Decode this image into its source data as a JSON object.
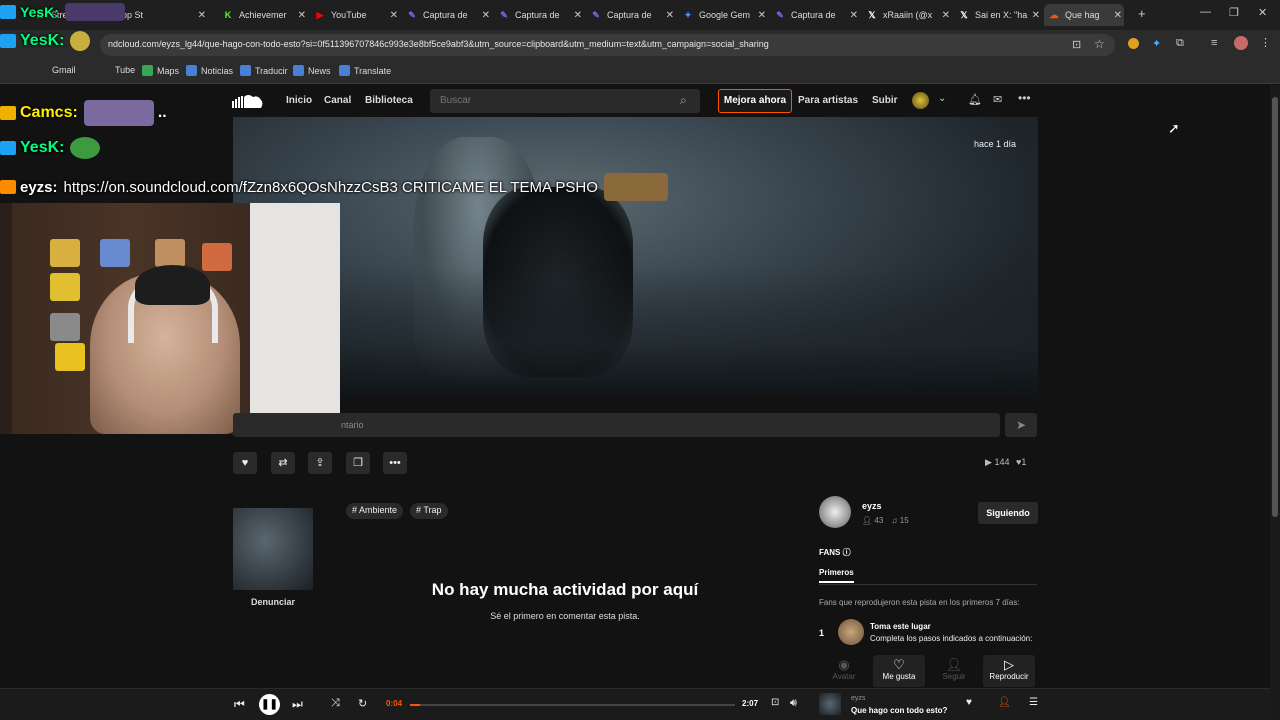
{
  "browser": {
    "tabs": [
      {
        "label": "Stream - Kic",
        "icon": "kick-icon",
        "color": "#53fc18"
      },
      {
        "label": "app St",
        "icon": "app-icon",
        "color": "#888888"
      },
      {
        "label": "Achievemer",
        "icon": "kick-icon",
        "color": "#53fc18"
      },
      {
        "label": "YouTube",
        "icon": "youtube-icon",
        "color": "#ff0000"
      },
      {
        "label": "Captura de",
        "icon": "capture-icon",
        "color": "#8a5cf6"
      },
      {
        "label": "Captura de",
        "icon": "capture-icon",
        "color": "#8a5cf6"
      },
      {
        "label": "Captura de",
        "icon": "capture-icon",
        "color": "#8a5cf6"
      },
      {
        "label": "Google Gem",
        "icon": "gemini-icon",
        "color": "#4a8cff"
      },
      {
        "label": "Captura de",
        "icon": "capture-icon",
        "color": "#8a5cf6"
      },
      {
        "label": "xRaaiin (@x",
        "icon": "x-icon",
        "color": "#ffffff"
      },
      {
        "label": "Sai en X: \"ha",
        "icon": "x-icon",
        "color": "#ffffff"
      },
      {
        "label": "Que hag",
        "icon": "soundcloud-icon",
        "color": "#ff5500"
      }
    ],
    "url": "ndcloud.com/eyzs_lg44/que-hago-con-todo-esto?si=0f511396707846c993e3e8bf5ce9abf3&utm_source=clipboard&utm_medium=text&utm_campaign=social_sharing",
    "bookmarks": [
      {
        "label": "Gmail"
      },
      {
        "label": "Tube"
      },
      {
        "label": "Maps"
      },
      {
        "label": "Noticias"
      },
      {
        "label": "Traducir"
      },
      {
        "label": "News"
      },
      {
        "label": "Translate"
      }
    ]
  },
  "chat": [
    {
      "user": "YesK:",
      "text": "",
      "user_color": "#00ff7f"
    },
    {
      "user": "YesK:",
      "text": "",
      "user_color": "#00ff7f"
    },
    {
      "user": "Camcs:",
      "text": "..",
      "user_color": "#ffee00"
    },
    {
      "user": "YesK:",
      "text": "",
      "user_color": "#00ff7f"
    },
    {
      "user": "eyzs:",
      "text": "https://on.soundcloud.com/fZzn8x6QOsNhzzCsB3 CRITICAME EL TEMA PSHO",
      "user_color": "#ffffff"
    }
  ],
  "header": {
    "nav": [
      "Inicio",
      "Canal",
      "Biblioteca"
    ],
    "search_placeholder": "Buscar",
    "upgrade": "Mejora ahora",
    "artists": "Para artistas",
    "upload": "Subir"
  },
  "track": {
    "time_ago": "hace 1 día",
    "comment_placeholder": "ntario",
    "plays": "144",
    "likes": "1",
    "tags": [
      "# Ambiente",
      "# Trap"
    ],
    "report": "Denunciar",
    "empty_title": "No hay mucha actividad por aquí",
    "empty_sub": "Sé el primero en comentar esta pista."
  },
  "artist": {
    "name": "eyzs",
    "followers": "43",
    "tracks": "15",
    "follow_label": "Siguiendo"
  },
  "fans": {
    "title": "FANS",
    "tab": "Primeros",
    "desc": "Fans que reprodujeron esta pista en los primeros 7 días:",
    "rank": "1",
    "slot_title": "Toma este lugar",
    "slot_desc": "Completa los pasos indicados a continuación:",
    "actions": [
      "Avatar",
      "Me gusta",
      "Seguir",
      "Reproducir"
    ]
  },
  "player": {
    "elapsed": "0:04",
    "duration": "2:07",
    "progress": 0.03,
    "artist": "eyzs",
    "title": "Que hago con todo esto?"
  },
  "colors": {
    "accent": "#ff5500"
  }
}
